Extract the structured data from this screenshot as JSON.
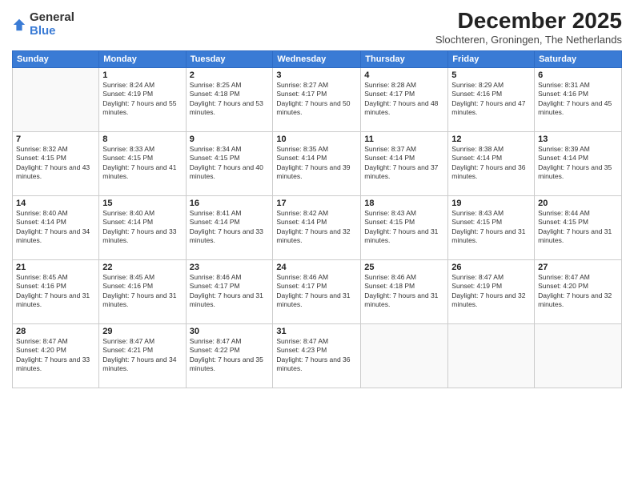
{
  "logo": {
    "general": "General",
    "blue": "Blue"
  },
  "title": "December 2025",
  "location": "Slochteren, Groningen, The Netherlands",
  "headers": [
    "Sunday",
    "Monday",
    "Tuesday",
    "Wednesday",
    "Thursday",
    "Friday",
    "Saturday"
  ],
  "weeks": [
    [
      {
        "day": "",
        "sunrise": "",
        "sunset": "",
        "daylight": ""
      },
      {
        "day": "1",
        "sunrise": "Sunrise: 8:24 AM",
        "sunset": "Sunset: 4:19 PM",
        "daylight": "Daylight: 7 hours and 55 minutes."
      },
      {
        "day": "2",
        "sunrise": "Sunrise: 8:25 AM",
        "sunset": "Sunset: 4:18 PM",
        "daylight": "Daylight: 7 hours and 53 minutes."
      },
      {
        "day": "3",
        "sunrise": "Sunrise: 8:27 AM",
        "sunset": "Sunset: 4:17 PM",
        "daylight": "Daylight: 7 hours and 50 minutes."
      },
      {
        "day": "4",
        "sunrise": "Sunrise: 8:28 AM",
        "sunset": "Sunset: 4:17 PM",
        "daylight": "Daylight: 7 hours and 48 minutes."
      },
      {
        "day": "5",
        "sunrise": "Sunrise: 8:29 AM",
        "sunset": "Sunset: 4:16 PM",
        "daylight": "Daylight: 7 hours and 47 minutes."
      },
      {
        "day": "6",
        "sunrise": "Sunrise: 8:31 AM",
        "sunset": "Sunset: 4:16 PM",
        "daylight": "Daylight: 7 hours and 45 minutes."
      }
    ],
    [
      {
        "day": "7",
        "sunrise": "Sunrise: 8:32 AM",
        "sunset": "Sunset: 4:15 PM",
        "daylight": "Daylight: 7 hours and 43 minutes."
      },
      {
        "day": "8",
        "sunrise": "Sunrise: 8:33 AM",
        "sunset": "Sunset: 4:15 PM",
        "daylight": "Daylight: 7 hours and 41 minutes."
      },
      {
        "day": "9",
        "sunrise": "Sunrise: 8:34 AM",
        "sunset": "Sunset: 4:15 PM",
        "daylight": "Daylight: 7 hours and 40 minutes."
      },
      {
        "day": "10",
        "sunrise": "Sunrise: 8:35 AM",
        "sunset": "Sunset: 4:14 PM",
        "daylight": "Daylight: 7 hours and 39 minutes."
      },
      {
        "day": "11",
        "sunrise": "Sunrise: 8:37 AM",
        "sunset": "Sunset: 4:14 PM",
        "daylight": "Daylight: 7 hours and 37 minutes."
      },
      {
        "day": "12",
        "sunrise": "Sunrise: 8:38 AM",
        "sunset": "Sunset: 4:14 PM",
        "daylight": "Daylight: 7 hours and 36 minutes."
      },
      {
        "day": "13",
        "sunrise": "Sunrise: 8:39 AM",
        "sunset": "Sunset: 4:14 PM",
        "daylight": "Daylight: 7 hours and 35 minutes."
      }
    ],
    [
      {
        "day": "14",
        "sunrise": "Sunrise: 8:40 AM",
        "sunset": "Sunset: 4:14 PM",
        "daylight": "Daylight: 7 hours and 34 minutes."
      },
      {
        "day": "15",
        "sunrise": "Sunrise: 8:40 AM",
        "sunset": "Sunset: 4:14 PM",
        "daylight": "Daylight: 7 hours and 33 minutes."
      },
      {
        "day": "16",
        "sunrise": "Sunrise: 8:41 AM",
        "sunset": "Sunset: 4:14 PM",
        "daylight": "Daylight: 7 hours and 33 minutes."
      },
      {
        "day": "17",
        "sunrise": "Sunrise: 8:42 AM",
        "sunset": "Sunset: 4:14 PM",
        "daylight": "Daylight: 7 hours and 32 minutes."
      },
      {
        "day": "18",
        "sunrise": "Sunrise: 8:43 AM",
        "sunset": "Sunset: 4:15 PM",
        "daylight": "Daylight: 7 hours and 31 minutes."
      },
      {
        "day": "19",
        "sunrise": "Sunrise: 8:43 AM",
        "sunset": "Sunset: 4:15 PM",
        "daylight": "Daylight: 7 hours and 31 minutes."
      },
      {
        "day": "20",
        "sunrise": "Sunrise: 8:44 AM",
        "sunset": "Sunset: 4:15 PM",
        "daylight": "Daylight: 7 hours and 31 minutes."
      }
    ],
    [
      {
        "day": "21",
        "sunrise": "Sunrise: 8:45 AM",
        "sunset": "Sunset: 4:16 PM",
        "daylight": "Daylight: 7 hours and 31 minutes."
      },
      {
        "day": "22",
        "sunrise": "Sunrise: 8:45 AM",
        "sunset": "Sunset: 4:16 PM",
        "daylight": "Daylight: 7 hours and 31 minutes."
      },
      {
        "day": "23",
        "sunrise": "Sunrise: 8:46 AM",
        "sunset": "Sunset: 4:17 PM",
        "daylight": "Daylight: 7 hours and 31 minutes."
      },
      {
        "day": "24",
        "sunrise": "Sunrise: 8:46 AM",
        "sunset": "Sunset: 4:17 PM",
        "daylight": "Daylight: 7 hours and 31 minutes."
      },
      {
        "day": "25",
        "sunrise": "Sunrise: 8:46 AM",
        "sunset": "Sunset: 4:18 PM",
        "daylight": "Daylight: 7 hours and 31 minutes."
      },
      {
        "day": "26",
        "sunrise": "Sunrise: 8:47 AM",
        "sunset": "Sunset: 4:19 PM",
        "daylight": "Daylight: 7 hours and 32 minutes."
      },
      {
        "day": "27",
        "sunrise": "Sunrise: 8:47 AM",
        "sunset": "Sunset: 4:20 PM",
        "daylight": "Daylight: 7 hours and 32 minutes."
      }
    ],
    [
      {
        "day": "28",
        "sunrise": "Sunrise: 8:47 AM",
        "sunset": "Sunset: 4:20 PM",
        "daylight": "Daylight: 7 hours and 33 minutes."
      },
      {
        "day": "29",
        "sunrise": "Sunrise: 8:47 AM",
        "sunset": "Sunset: 4:21 PM",
        "daylight": "Daylight: 7 hours and 34 minutes."
      },
      {
        "day": "30",
        "sunrise": "Sunrise: 8:47 AM",
        "sunset": "Sunset: 4:22 PM",
        "daylight": "Daylight: 7 hours and 35 minutes."
      },
      {
        "day": "31",
        "sunrise": "Sunrise: 8:47 AM",
        "sunset": "Sunset: 4:23 PM",
        "daylight": "Daylight: 7 hours and 36 minutes."
      },
      {
        "day": "",
        "sunrise": "",
        "sunset": "",
        "daylight": ""
      },
      {
        "day": "",
        "sunrise": "",
        "sunset": "",
        "daylight": ""
      },
      {
        "day": "",
        "sunrise": "",
        "sunset": "",
        "daylight": ""
      }
    ]
  ]
}
